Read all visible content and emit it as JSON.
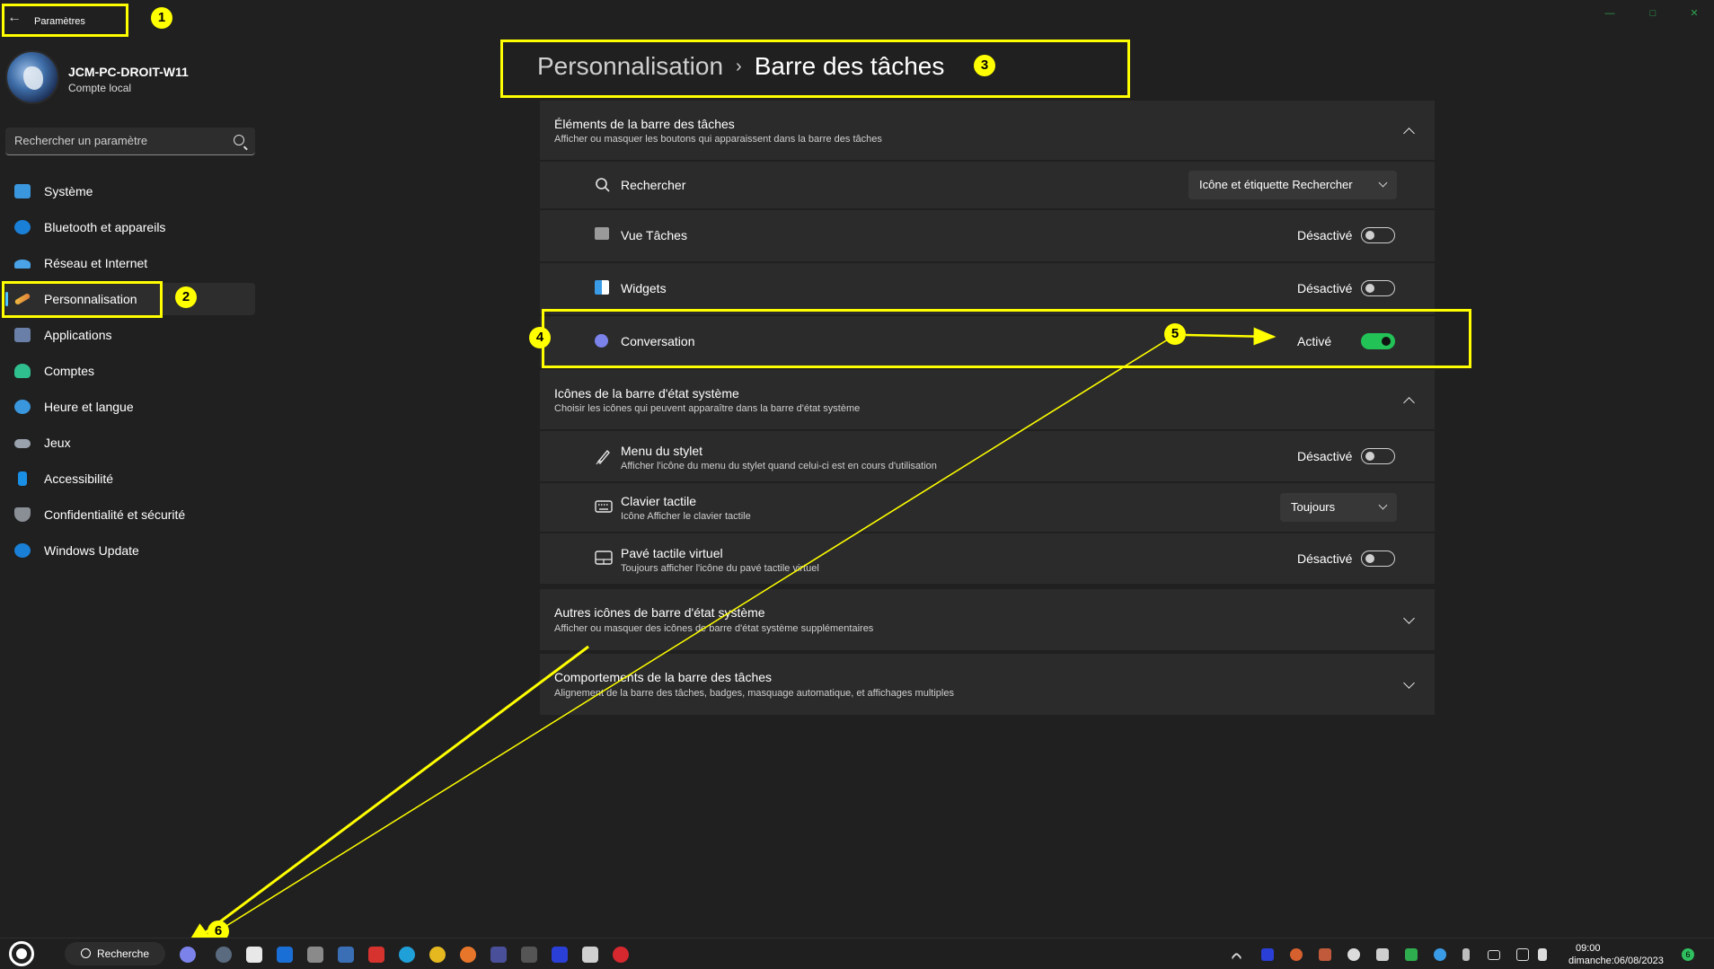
{
  "window": {
    "title": "Paramètres",
    "back_icon": "arrow-left-icon"
  },
  "account": {
    "name": "JCM-PC-DROIT-W11",
    "type": "Compte local"
  },
  "search": {
    "placeholder": "Rechercher un paramètre"
  },
  "sidebar": {
    "items": [
      {
        "label": "Système",
        "icon": "monitor-icon",
        "color": "#3a96dd"
      },
      {
        "label": "Bluetooth et appareils",
        "icon": "bluetooth-icon",
        "color": "#1a7fd6"
      },
      {
        "label": "Réseau et Internet",
        "icon": "wifi-icon",
        "color": "#4aa3e6"
      },
      {
        "label": "Personnalisation",
        "icon": "brush-icon",
        "color": "#e07a3a"
      },
      {
        "label": "Applications",
        "icon": "apps-icon",
        "color": "#6a7fa8"
      },
      {
        "label": "Comptes",
        "icon": "person-icon",
        "color": "#2fbf8f"
      },
      {
        "label": "Heure et langue",
        "icon": "globe-clock-icon",
        "color": "#3a96dd"
      },
      {
        "label": "Jeux",
        "icon": "gamepad-icon",
        "color": "#9aa3ad"
      },
      {
        "label": "Accessibilité",
        "icon": "accessibility-icon",
        "color": "#1a8fe6"
      },
      {
        "label": "Confidentialité et sécurité",
        "icon": "shield-icon",
        "color": "#8a8f96"
      },
      {
        "label": "Windows Update",
        "icon": "update-icon",
        "color": "#1a7fd6"
      }
    ],
    "selected_index": 3,
    "accent": "#4cc2ff"
  },
  "header": {
    "parent": "Personnalisation",
    "separator": "›",
    "current": "Barre des tâches"
  },
  "sections": {
    "taskbar_items": {
      "title": "Éléments de la barre des tâches",
      "desc": "Afficher ou masquer les boutons qui apparaissent dans la barre des tâches",
      "rows": {
        "search": {
          "label": "Rechercher",
          "icon": "search-icon",
          "value": "Icône et étiquette Rechercher"
        },
        "task_view": {
          "label": "Vue Tâches",
          "icon": "task-view-icon",
          "state": "Désactivé",
          "on": false
        },
        "widgets": {
          "label": "Widgets",
          "icon": "widgets-icon",
          "state": "Désactivé",
          "on": false
        },
        "chat": {
          "label": "Conversation",
          "icon": "chat-icon",
          "state": "Activé",
          "on": true
        }
      }
    },
    "tray_icons": {
      "title": "Icônes de la barre d'état système",
      "desc": "Choisir les icônes qui peuvent apparaître dans la barre d'état système",
      "rows": {
        "pen": {
          "label": "Menu du stylet",
          "desc": "Afficher l'icône du menu du stylet quand celui-ci est en cours d'utilisation",
          "icon": "pen-icon",
          "state": "Désactivé",
          "on": false
        },
        "keyboard": {
          "label": "Clavier tactile",
          "desc": "Icône Afficher le clavier tactile",
          "icon": "keyboard-icon",
          "value": "Toujours"
        },
        "touchpad": {
          "label": "Pavé tactile virtuel",
          "desc": "Toujours afficher l'icône du pavé tactile virtuel",
          "icon": "touchpad-icon",
          "state": "Désactivé",
          "on": false
        }
      }
    },
    "other_tray": {
      "title": "Autres icônes de barre d'état système",
      "desc": "Afficher ou masquer des icônes de barre d'état système supplémentaires"
    },
    "behaviors": {
      "title": "Comportements de la barre des tâches",
      "desc": "Alignement de la barre des tâches, badges, masquage automatique, et affichages multiples"
    }
  },
  "annotations": {
    "color": "#ffff00",
    "badges": [
      "1",
      "2",
      "3",
      "4",
      "5",
      "6"
    ]
  },
  "taskbar": {
    "search_label": "Recherche",
    "time": "09:00",
    "date": "dimanche:06/08/2023",
    "notification_count": "6",
    "accent_toggle_on": "#23c257"
  }
}
